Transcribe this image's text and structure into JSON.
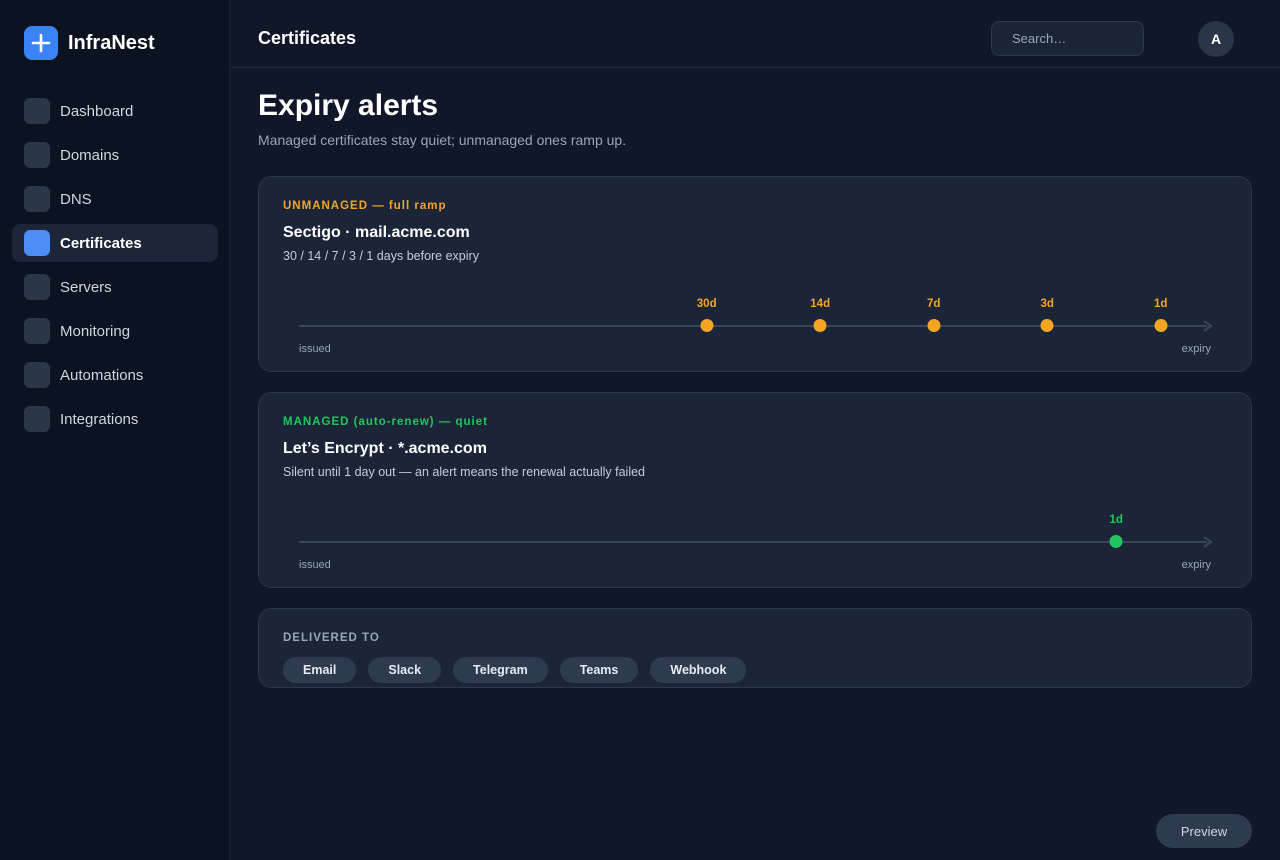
{
  "brand": {
    "name": "InfraNest"
  },
  "sidebar": {
    "items": [
      {
        "label": "Dashboard",
        "active": false
      },
      {
        "label": "Domains",
        "active": false
      },
      {
        "label": "DNS",
        "active": false
      },
      {
        "label": "Certificates",
        "active": true
      },
      {
        "label": "Servers",
        "active": false
      },
      {
        "label": "Monitoring",
        "active": false
      },
      {
        "label": "Automations",
        "active": false
      },
      {
        "label": "Integrations",
        "active": false
      }
    ]
  },
  "header": {
    "title": "Certificates",
    "search_placeholder": "Search…",
    "avatar_initial": "A"
  },
  "main": {
    "title": "Expiry alerts",
    "subtitle": "Managed certificates stay quiet; unmanaged ones ramp up."
  },
  "cards": [
    {
      "tag": "UNMANAGED — full ramp",
      "tag_color": "#f5a524",
      "title": "Sectigo · mail.acme.com",
      "description": "30 / 14 / 7 / 3 / 1 days before expiry",
      "timeline_start": "issued",
      "timeline_end": "expiry",
      "marker_color": "#f5a524",
      "markers": [
        {
          "label": "30d",
          "position": 0.449
        },
        {
          "label": "14d",
          "position": 0.574
        },
        {
          "label": "7d",
          "position": 0.699
        },
        {
          "label": "3d",
          "position": 0.824
        },
        {
          "label": "1d",
          "position": 0.949
        }
      ]
    },
    {
      "tag": "MANAGED (auto-renew) — quiet",
      "tag_color": "#22c55e",
      "title": "Let’s Encrypt · *.acme.com",
      "description": "Silent until 1 day out — an alert means the renewal actually failed",
      "timeline_start": "issued",
      "timeline_end": "expiry",
      "marker_color": "#22c55e",
      "markers": [
        {
          "label": "1d",
          "position": 0.9
        }
      ]
    }
  ],
  "delivery": {
    "label": "DELIVERED TO",
    "channels": [
      "Email",
      "Slack",
      "Telegram",
      "Teams",
      "Webhook"
    ]
  },
  "footer": {
    "preview_label": "Preview"
  }
}
